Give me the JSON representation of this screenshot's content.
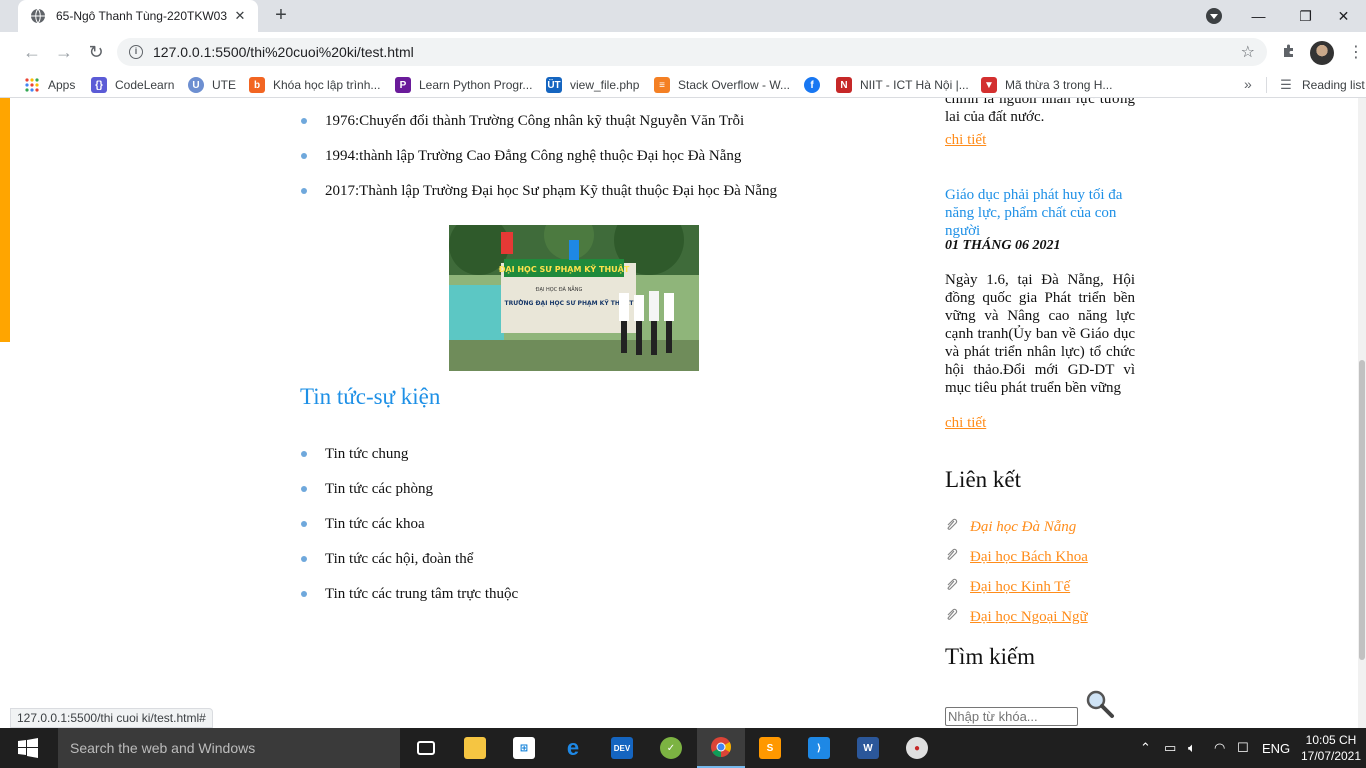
{
  "browser": {
    "tab_title": "65-Ngô Thanh Tùng-220TKW03",
    "tab_close": "✕",
    "new_tab": "+",
    "url": "127.0.0.1:5500/thi%20cuoi%20ki/test.html",
    "window_controls": {
      "minimize": "—",
      "maximize": "❐",
      "close": "✕"
    },
    "bookmarks": [
      {
        "label": "Apps",
        "icon": "apps-grid-icon"
      },
      {
        "label": "CodeLearn",
        "icon": "codelearn-icon"
      },
      {
        "label": "UTE",
        "icon": "ute-icon"
      },
      {
        "label": "Khóa học lập trình...",
        "icon": "b-icon"
      },
      {
        "label": "Learn Python Progr...",
        "icon": "python-icon"
      },
      {
        "label": "view_file.php",
        "icon": "ut-icon"
      },
      {
        "label": "Stack Overflow - W...",
        "icon": "stackoverflow-icon"
      },
      {
        "label": "",
        "icon": "facebook-icon"
      },
      {
        "label": "NIIT - ICT Hà Nội |...",
        "icon": "niit-icon"
      },
      {
        "label": "Mã thừa 3 trong H...",
        "icon": "v-icon"
      }
    ],
    "bookmarks_more": "»",
    "reading_list": "Reading list"
  },
  "main": {
    "history": [
      "1976:Chuyển đổi thành Trường Công nhân kỹ thuật Nguyễn Văn Trỗi",
      "1994:thành lập Trường Cao Đẳng Công nghệ thuộc Đại học Đà Nẵng",
      "2017:Thành lập Trường Đại học Sư phạm Kỹ thuật thuộc Đại học Đà Nẵng"
    ],
    "photo": {
      "banner": "ĐẠI HỌC SƯ PHẠM KỸ THUẬT",
      "sub": "ĐẠI HỌC ĐÀ NẴNG",
      "sign": "TRƯỜNG ĐẠI HỌC SƯ PHẠM KỸ THUẬT"
    },
    "section_title": "Tin tức-sự kiện",
    "news_items": [
      "Tin tức chung",
      "Tin tức các phòng",
      "Tin tức các khoa",
      "Tin tức các hội, đoàn thể",
      "Tin tức các trung tâm trực thuộc"
    ]
  },
  "sidebar": {
    "prev_text_tail": "chính là nguồn nhân lực tương lai của đất nước.",
    "prev_link": "chi tiết",
    "news_title": "Giáo dục phải phát huy tối đa năng lực, phẩm chất của con người",
    "news_date": "01 THÁNG 06 2021",
    "news_body": "Ngày 1.6, tại Đà Nẵng, Hội đồng quốc gia Phát triển bền vững và Nâng cao năng lực cạnh tranh(Ủy ban về Giáo dục và phát triển nhân lực) tổ chức hội thảo.Đổi mới GD-DT vì mục tiêu phát truển bền vững",
    "news_link": "chi tiết",
    "links_heading": "Liên kết",
    "links": [
      "Đại học Đà Nẵng",
      "Đại học Bách Khoa",
      "Đại học Kinh Tế",
      "Đại học Ngoại Ngữ"
    ],
    "search_heading": "Tìm kiếm",
    "search_placeholder": "Nhập từ khóa..."
  },
  "status_bar": "127.0.0.1:5500/thi cuoi ki/test.html#",
  "taskbar": {
    "search_placeholder": "Search the web and Windows",
    "language": "ENG",
    "time": "10:05 CH",
    "date": "17/07/2021",
    "apps": [
      "task-view",
      "file-explorer",
      "store",
      "edge",
      "devc",
      "greenshot",
      "chrome",
      "sublime-text",
      "vscode",
      "word",
      "paint"
    ]
  },
  "colors": {
    "accent_orange": "#ffa500",
    "link_orange": "#ff8c1a",
    "heading_blue": "#1e90e6"
  }
}
